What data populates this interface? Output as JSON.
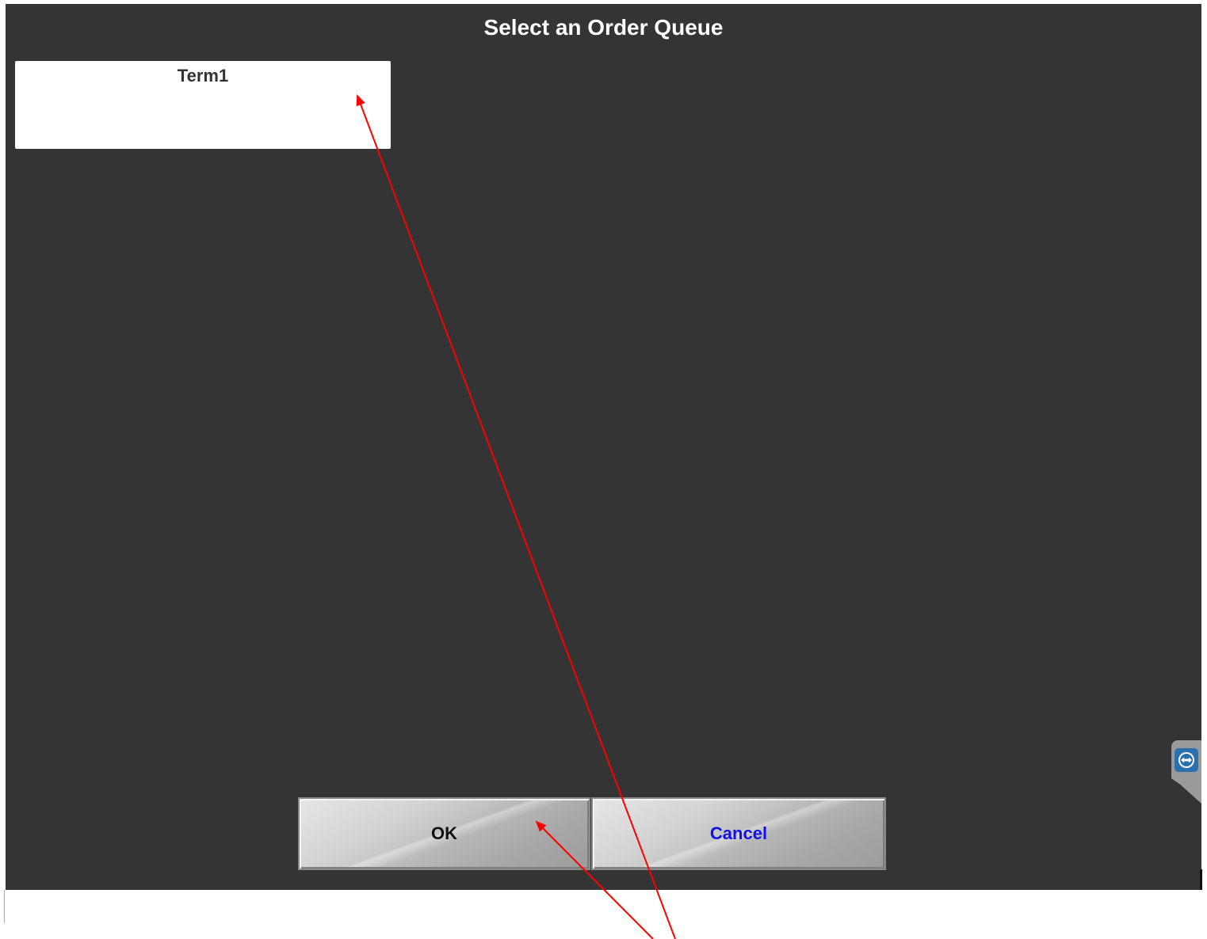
{
  "dialog": {
    "title": "Select an Order Queue",
    "queues": [
      {
        "label": "Term1"
      }
    ]
  },
  "buttons": {
    "ok_label": "OK",
    "cancel_label": "Cancel"
  },
  "colors": {
    "dialog_background": "#343434",
    "cancel_text": "#1010ee",
    "annotation_arrow": "#ff0000"
  },
  "icons": {
    "remote_support": "remote-support-icon"
  }
}
